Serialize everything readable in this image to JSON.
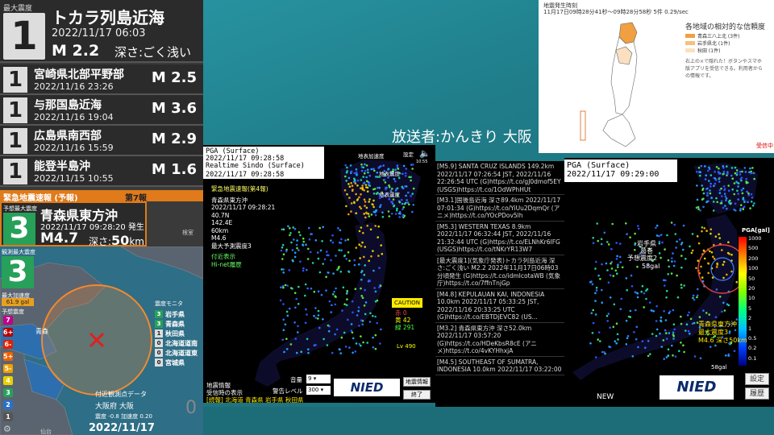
{
  "latest": {
    "label": "最大震度",
    "intensity": "1",
    "place": "トカラ列島近海",
    "time": "2022/11/17  06:03",
    "mag": "M 2.2",
    "depth": "深さ:ごく浅い"
  },
  "history": [
    {
      "intensity": "1",
      "place": "宮崎県北部平野部",
      "time": "2022/11/16  23:26",
      "mag": "M 2.5"
    },
    {
      "intensity": "1",
      "place": "与那国島近海",
      "time": "2022/11/16  19:04",
      "mag": "M 3.6"
    },
    {
      "intensity": "1",
      "place": "広島県南西部",
      "time": "2022/11/16  15:59",
      "mag": "M 2.9"
    },
    {
      "intensity": "1",
      "place": "能登半島沖",
      "time": "2022/11/15  10:55",
      "mag": "M 1.6"
    }
  ],
  "eew": {
    "title": "緊急地震速報 (予報)",
    "report_no": "第7報",
    "max_int_label": "予想最大震度",
    "intensity": "3",
    "place": "青森県東方沖",
    "time": "2022/11/17 09:28:20 発生",
    "mag": "M4.7",
    "depth_label": "深さ:",
    "depth_value": "50",
    "depth_unit": "km",
    "observed_label": "観測最大震度",
    "observed_int": "3",
    "pga_label": "最大加速度",
    "pga_value": "61.9 gal",
    "scale_title": "予想震度",
    "map_label": "青森"
  },
  "scale": [
    {
      "v": "7",
      "c": "#c0008a"
    },
    {
      "v": "6+",
      "c": "#b40000"
    },
    {
      "v": "6-",
      "c": "#e02000"
    },
    {
      "v": "5+",
      "c": "#f06000"
    },
    {
      "v": "5-",
      "c": "#f0a000"
    },
    {
      "v": "4",
      "c": "#e8d000"
    },
    {
      "v": "3",
      "c": "#27a05a"
    },
    {
      "v": "2",
      "c": "#2a70c8"
    },
    {
      "v": "1",
      "c": "#555555"
    }
  ],
  "monitor": {
    "title": "震度モニタ",
    "rows": [
      {
        "v": "3",
        "name": "岩手県",
        "c": "#27a05a"
      },
      {
        "v": "3",
        "name": "青森県",
        "c": "#27a05a"
      },
      {
        "v": "1",
        "name": "秋田県",
        "c": "#ddd"
      },
      {
        "v": "0",
        "name": "北海道道南",
        "c": "#ddd"
      },
      {
        "v": "0",
        "name": "北海道道東",
        "c": "#ddd"
      },
      {
        "v": "0",
        "name": "宮城県",
        "c": "#ddd"
      }
    ]
  },
  "nearest": {
    "title": "付近観測点データ",
    "place": "大阪府 大阪",
    "value": "0",
    "seis": "震度 -0.8  加速度 0.20",
    "clock": "2022/11/17 09:29:01"
  },
  "map_labels": {
    "nemuro": "根室",
    "sendai": "仙台"
  },
  "reliability": {
    "head1": "地震発生時刻",
    "head2": "11月17日09時28分41秒〜09時28分58秒   5件   0.29/sec",
    "title": "各地域の相対的な信頼度",
    "legend": [
      {
        "label": "青森三八上北 (3件)",
        "c": "#f0a040"
      },
      {
        "label": "岩手県北 (1件)",
        "c": "#f5c080"
      },
      {
        "label": "秋田 (1件)",
        "c": "#fae0c0"
      }
    ],
    "note": "右上の×で隠れた！ボタンやスマホ版アプリを受信できる。利用者からの情報です。",
    "received": "受信中"
  },
  "caster": "放送者:かんきり  大阪",
  "mid": {
    "pga_line1": "PGA (Surface)",
    "pga_line2": "2022/11/17 09:28:58",
    "sindo_line1": "Realtime Sindo (Surface)",
    "sindo_line2": "2022/11/17 09:28:58",
    "report": "緊急地震速報(第4報)",
    "detail": [
      "青森県東方沖",
      "2022/11/17 09:28:21",
      "40.7N",
      "142.4E",
      "60km",
      "M4.6",
      "最大予測震度3"
    ],
    "kyoshin": "付近表示",
    "hinet": "Hi-net履歴",
    "caution": "CAUTION",
    "caution_red": "赤 0",
    "caution_yellow": "黄 42",
    "caution_green": "緑 291",
    "level": "Lv 490",
    "top_labels": [
      "地表加速度",
      "設定",
      "地表震度"
    ],
    "time_small": "10:55",
    "bottom1": "地震情報",
    "bottom2": "受信時の表示",
    "bottom3": "[続報] 北海道 青森県 岩手県 秋田県",
    "vol_label": "音量",
    "vol_value": "9",
    "warn_label": "警告レベル",
    "warn_value": "300",
    "btn1": "地震情報",
    "btn2": "終了",
    "nied": "NIED"
  },
  "tweets": [
    "[M5.9] SANTA CRUZ ISLANDS 149.2km 2022/11/17 07:26:54 JST, 2022/11/16 22:26:54 UTC (G)https://t.co/gJ0dmof5EY (USGS)https://t.co/1OdWPhHUt",
    "[M3.1]国後島近海 深さ89.4km 2022/11/17 07:01:34 (G)https://t.co/YiUu2DqmQr (アニメ)https://t.co/YOcPDov5lh",
    "[M5.3] WESTERN TEXAS 8.9km 2022/11/17 06:32:44 JST, 2022/11/16 21:32:44 UTC (G)https://t.co/ELNhKr6IFG (USGS)https://t.co/tNKrYR13W7",
    "[最大震度1](気象庁発表)トカラ列島近海 深さ:ごく浅い M2.2 2022年11月17日06時03分頃発生 (G)https://t.co/idmIcotaWB (気象庁)https://t.co/7ffnTnjGp",
    "[M4.8] KEPULAUAN KAI, INDONESIA 10.0km 2022/11/17 05:33:25 JST, 2022/11/16 20:33:25 UTC (G)https://t.co/EBTDjEVC82 (US...",
    "[M3.2] 青森県東方沖 深さ52.0km 2022/11/17 03:57:20 (G)https://t.co/HDeKbsR8cE (アニメ)https://t.co/4vKYHhxjA",
    "[M4.5] SOUTHEAST OF SUMATRA, INDONESIA 10.0km 2022/11/17 03:22:00"
  ],
  "right": {
    "pga_line1": "PGA (Surface)",
    "pga_line2": "2022/11/17 09:29:00",
    "pga_unit": "PGA[gal]",
    "ticks": [
      "1000",
      "500",
      "200",
      "100",
      "50",
      "20",
      "10",
      "5",
      "2",
      "1",
      "0.5",
      "0.2",
      "0.1"
    ],
    "iwate_name": "岩手県",
    "iwate_sub": "葛巻",
    "iwate_int": "予想震度2",
    "iwate_gal": "58gal",
    "aomori_name": "青森県東方沖",
    "aomori_int": "最大震度3",
    "aomori_mag": "M4.6 深さ50km",
    "gal_small": "58gal",
    "new": "NEW",
    "btn_settings": "設定",
    "btn_history": "履歴",
    "nied": "NIED"
  },
  "colors": {
    "accent_orange": "#e07a1a",
    "int3_green": "#27a05a",
    "map_land": "#5a6470"
  }
}
